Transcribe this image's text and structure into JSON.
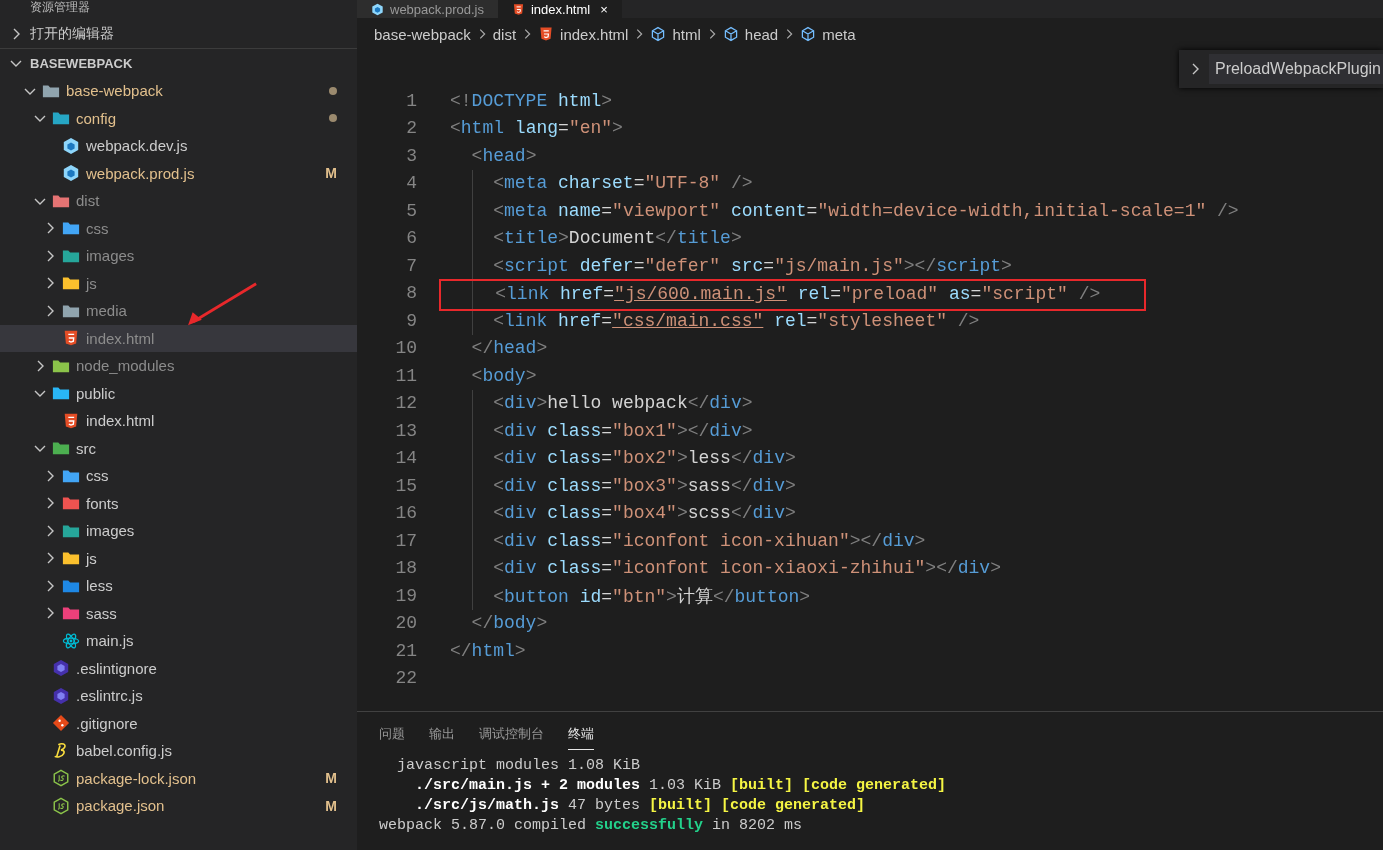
{
  "sidebar": {
    "title": "资源管理器",
    "sections": [
      {
        "label": "打开的编辑器",
        "expanded": false
      },
      {
        "label": "BASEWEBPACK",
        "expanded": true
      }
    ],
    "tree": [
      {
        "label": "base-webpack",
        "kind": "folder",
        "modified": true,
        "ignored": false,
        "dot": true,
        "expanded": true,
        "selected": false,
        "children": [
          {
            "label": "config",
            "kind": "config-folder",
            "modified": true,
            "ignored": false,
            "dot": true,
            "expanded": true,
            "selected": false,
            "children": [
              {
                "label": "webpack.dev.js",
                "kind": "webpack",
                "modified": false,
                "ignored": false,
                "selected": false
              },
              {
                "label": "webpack.prod.js",
                "kind": "webpack",
                "modified": true,
                "ignored": false,
                "decoration": "M",
                "selected": false
              }
            ]
          },
          {
            "label": "dist",
            "kind": "dist-folder",
            "modified": false,
            "ignored": true,
            "expanded": true,
            "selected": false,
            "children": [
              {
                "label": "css",
                "kind": "css-folder",
                "modified": false,
                "ignored": true,
                "expanded": false,
                "selected": false
              },
              {
                "label": "images",
                "kind": "images-folder",
                "modified": false,
                "ignored": true,
                "expanded": false,
                "selected": false
              },
              {
                "label": "js",
                "kind": "js-folder",
                "modified": false,
                "ignored": true,
                "expanded": false,
                "selected": false
              },
              {
                "label": "media",
                "kind": "folder",
                "modified": false,
                "ignored": true,
                "expanded": false,
                "selected": false
              },
              {
                "label": "index.html",
                "kind": "html",
                "modified": false,
                "ignored": true,
                "selected": true
              }
            ]
          },
          {
            "label": "node_modules",
            "kind": "node-folder",
            "modified": false,
            "ignored": true,
            "expanded": false,
            "selected": false
          },
          {
            "label": "public",
            "kind": "public-folder",
            "modified": false,
            "ignored": false,
            "expanded": true,
            "selected": false,
            "children": [
              {
                "label": "index.html",
                "kind": "html",
                "modified": false,
                "ignored": false,
                "selected": false
              }
            ]
          },
          {
            "label": "src",
            "kind": "src-folder",
            "modified": false,
            "ignored": false,
            "expanded": true,
            "selected": false,
            "children": [
              {
                "label": "css",
                "kind": "css-folder",
                "modified": false,
                "ignored": false,
                "expanded": false,
                "selected": false
              },
              {
                "label": "fonts",
                "kind": "fonts-folder",
                "modified": false,
                "ignored": false,
                "expanded": false,
                "selected": false
              },
              {
                "label": "images",
                "kind": "images-folder",
                "modified": false,
                "ignored": false,
                "expanded": false,
                "selected": false
              },
              {
                "label": "js",
                "kind": "js-folder",
                "modified": false,
                "ignored": false,
                "expanded": false,
                "selected": false
              },
              {
                "label": "less",
                "kind": "less-folder",
                "modified": false,
                "ignored": false,
                "expanded": false,
                "selected": false
              },
              {
                "label": "sass",
                "kind": "sass-folder",
                "modified": false,
                "ignored": false,
                "expanded": false,
                "selected": false
              },
              {
                "label": "main.js",
                "kind": "react",
                "modified": false,
                "ignored": false,
                "selected": false
              }
            ]
          },
          {
            "label": ".eslintignore",
            "kind": "eslint",
            "modified": false,
            "ignored": false,
            "selected": false
          },
          {
            "label": ".eslintrc.js",
            "kind": "eslint",
            "modified": false,
            "ignored": false,
            "selected": false
          },
          {
            "label": ".gitignore",
            "kind": "git",
            "modified": false,
            "ignored": false,
            "selected": false
          },
          {
            "label": "babel.config.js",
            "kind": "babel",
            "modified": false,
            "ignored": false,
            "selected": false
          },
          {
            "label": "package-lock.json",
            "kind": "node",
            "modified": true,
            "ignored": false,
            "decoration": "M",
            "selected": false
          },
          {
            "label": "package.json",
            "kind": "node",
            "modified": true,
            "ignored": false,
            "decoration": "M",
            "selected": false
          }
        ]
      }
    ]
  },
  "tabs": [
    {
      "label": "webpack.prod.js",
      "kind": "webpack",
      "selected": false
    },
    {
      "label": "index.html",
      "kind": "html",
      "selected": true,
      "close": "×"
    }
  ],
  "breadcrumbs": [
    {
      "label": "base-webpack",
      "kind": "none"
    },
    {
      "label": "dist",
      "kind": "none"
    },
    {
      "label": "index.html",
      "kind": "html"
    },
    {
      "label": "html",
      "kind": "element"
    },
    {
      "label": "head",
      "kind": "element"
    },
    {
      "label": "meta",
      "kind": "element"
    }
  ],
  "sticky_popup": {
    "label": "PreloadWebpackPlugin"
  },
  "lines": [
    {
      "number": "1",
      "highlighted": false,
      "text": "<!DOCTYPE html>"
    },
    {
      "number": "2",
      "highlighted": false,
      "text": "<html lang=\"en\">"
    },
    {
      "number": "3",
      "highlighted": false,
      "text": "  <head>"
    },
    {
      "number": "4",
      "highlighted": false,
      "text": "    <meta charset=\"UTF-8\" />"
    },
    {
      "number": "5",
      "highlighted": false,
      "text": "    <meta name=\"viewport\" content=\"width=device-width,initial-scale=1\" />"
    },
    {
      "number": "6",
      "highlighted": false,
      "text": "    <title>Document</title>"
    },
    {
      "number": "7",
      "highlighted": false,
      "text": "    <script defer=\"defer\" src=\"js/main.js\"></script>"
    },
    {
      "number": "8",
      "highlighted": true,
      "text": "    <link href=\"js/600.main.js\" rel=\"preload\" as=\"script\" />"
    },
    {
      "number": "9",
      "highlighted": false,
      "text": "    <link href=\"css/main.css\" rel=\"stylesheet\" />"
    },
    {
      "number": "10",
      "highlighted": false,
      "text": "  </head>"
    },
    {
      "number": "11",
      "highlighted": false,
      "text": "  <body>"
    },
    {
      "number": "12",
      "highlighted": false,
      "text": "    <div>hello webpack</div>"
    },
    {
      "number": "13",
      "highlighted": false,
      "text": "    <div class=\"box1\"></div>"
    },
    {
      "number": "14",
      "highlighted": false,
      "text": "    <div class=\"box2\">less</div>"
    },
    {
      "number": "15",
      "highlighted": false,
      "text": "    <div class=\"box3\">sass</div>"
    },
    {
      "number": "16",
      "highlighted": false,
      "text": "    <div class=\"box4\">scss</div>"
    },
    {
      "number": "17",
      "highlighted": false,
      "text": "    <div class=\"iconfont icon-xihuan\"></div>"
    },
    {
      "number": "18",
      "highlighted": false,
      "text": "    <div class=\"iconfont icon-xiaoxi-zhihui\"></div>"
    },
    {
      "number": "19",
      "highlighted": false,
      "text": "    <button id=\"btn\">计算</button>"
    },
    {
      "number": "20",
      "highlighted": false,
      "text": "  </body>"
    },
    {
      "number": "21",
      "highlighted": false,
      "text": "</html>"
    },
    {
      "number": "22"
    }
  ],
  "panel": {
    "tabs": [
      {
        "label": "问题",
        "selected": false
      },
      {
        "label": "输出",
        "selected": false
      },
      {
        "label": "调试控制台",
        "selected": false
      },
      {
        "label": "终端",
        "selected": true
      }
    ],
    "terminal": [
      {
        "kind": "plain",
        "text": "javascript modules 1.08 KiB"
      },
      {
        "kind": "build",
        "text": "**./src/main.js + 2 modules** 1.03 KiB **[built] [code generated]**"
      },
      {
        "kind": "build",
        "text": "**./src/js/math.js** 47 bytes **[built] [code generated]**"
      },
      {
        "kind": "done",
        "text": "webpack 5.87.0 compiled **successfully** in 8202 ms"
      }
    ]
  }
}
